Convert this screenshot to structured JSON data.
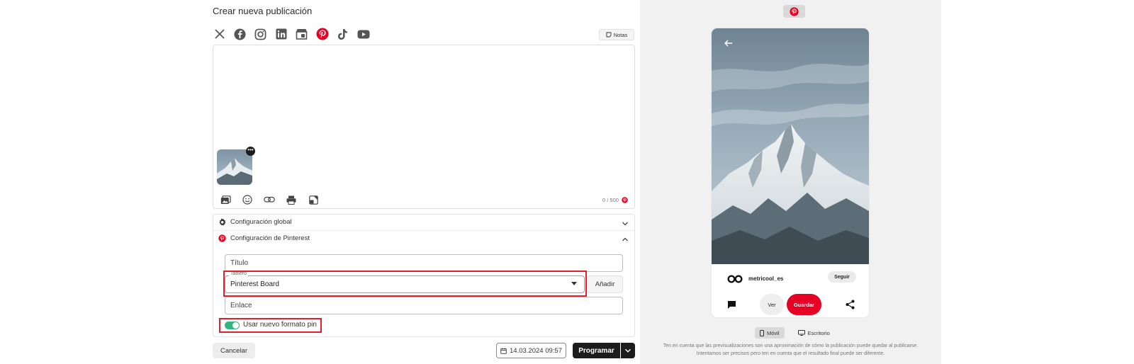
{
  "editor": {
    "title": "Crear nueva publicación",
    "social_networks": [
      "x-icon",
      "facebook-icon",
      "instagram-icon",
      "linkedin-icon",
      "google-business-icon",
      "pinterest-icon",
      "tiktok-icon",
      "youtube-icon"
    ],
    "notes_label": "Notas",
    "attachment_menu_label": "•••",
    "char_counter": "0 / 500",
    "toolbar_icons": [
      "media-icon",
      "emoji-icon",
      "link-icon",
      "print-icon",
      "canva-icon"
    ]
  },
  "accordion": {
    "global_label": "Configuración global",
    "pinterest_label": "Configuración de Pinterest"
  },
  "pinterest_form": {
    "title_placeholder": "Título",
    "board_label": "Tablero",
    "board_value": "Pinterest Board",
    "add_label": "Añadir",
    "link_placeholder": "Enlace",
    "new_pin_format_label": "Usar nuevo formato pin",
    "new_pin_format_enabled": true
  },
  "footer": {
    "cancel_label": "Cancelar",
    "date_value": "14.03.2024 09:57",
    "schedule_label": "Programar"
  },
  "preview": {
    "network_icon": "pinterest-icon",
    "username": "metricool_es",
    "follow_label": "Seguir",
    "view_label": "Ver",
    "save_label": "Guardar",
    "mode_mobile": "Móvil",
    "mode_desktop": "Escritorio",
    "active_mode": "Móvil",
    "disclaimer_line1": "Ten en cuenta que las previsualizaciones son una aproximación de cómo la publicación puede quedar al publicarse.",
    "disclaimer_line2": "Intentamos ser precisos pero ten en cuenta que el resultado final puede ser diferente."
  },
  "colors": {
    "pinterest_red": "#e60023",
    "highlight_red": "#e0202d",
    "toggle_green": "#33b57f",
    "primary_dark": "#1c1c1c"
  }
}
